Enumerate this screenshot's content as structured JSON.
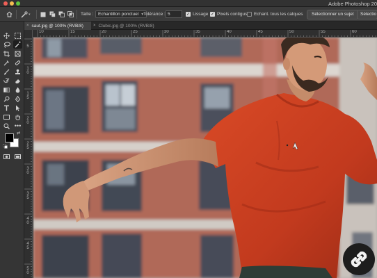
{
  "window": {
    "app_title": "Adobe Photoshop 20",
    "traffic_lights": {
      "close": "#ee5f57",
      "minimize": "#f4bd4f",
      "maximize": "#5fc53f"
    }
  },
  "options_bar": {
    "home_icon": "home-icon",
    "tool_icon": "spot-healing-brush-icon",
    "size_label": "Taille :",
    "sample_dropdown": "Echantillon ponctuel",
    "tolerance_label": "Tolérance :",
    "tolerance_value": "5",
    "antialias": {
      "label": "Lissage",
      "checked": true
    },
    "contiguous": {
      "label": "Pixels contigus",
      "checked": true
    },
    "all_layers": {
      "label": "Echant. tous les calques",
      "checked": false
    },
    "select_subject_button": "Sélectionner un sujet",
    "select_button": "Sélectio"
  },
  "tabs": [
    {
      "label": "saut.jpg @ 100% (RVB/8)",
      "active": true
    },
    {
      "label": "Clubic.jpg @ 100% (RVB/8)",
      "active": false
    }
  ],
  "rulers": {
    "top": [
      "10",
      "15",
      "20",
      "25",
      "30",
      "35",
      "40",
      "45",
      "50",
      "55",
      "60"
    ],
    "left": [
      "5",
      "10",
      "15",
      "20",
      "25",
      "30",
      "35",
      "40",
      "45",
      "50"
    ]
  },
  "toolbar": {
    "tools": [
      "move-icon",
      "marquee-icon",
      "lasso-icon",
      "magic-wand-icon",
      "crop-icon",
      "frame-icon",
      "eyedropper-icon",
      "spot-healing-icon",
      "brush-icon",
      "stamp-icon",
      "history-brush-icon",
      "eraser-icon",
      "gradient-icon",
      "blur-icon",
      "dodge-icon",
      "pen-icon",
      "type-icon",
      "path-select-icon",
      "rectangle-icon",
      "hand-icon",
      "zoom-icon",
      "more-tools-icon"
    ],
    "foreground_color": "#000000",
    "background_color": "#ffffff"
  },
  "canvas": {
    "subject_shirt_color": "#c93a1f",
    "link_badge_icon": "chain-link-icon"
  }
}
